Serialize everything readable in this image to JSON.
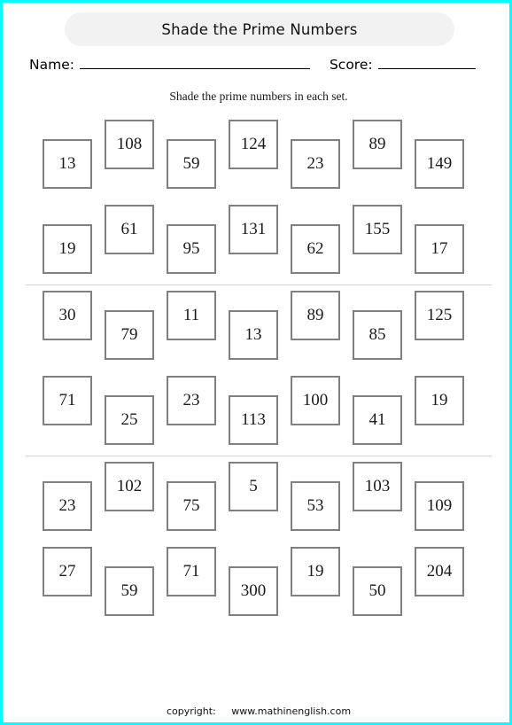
{
  "page": {
    "border_color": "#00ffff",
    "background": "#ffffff"
  },
  "header": {
    "title": "Shade the Prime Numbers",
    "banner_color": "#f2f2f2",
    "name_label": "Name:",
    "score_label": "Score:",
    "name_value": "",
    "score_value": "",
    "instructions": "Shade the prime numbers in each set."
  },
  "box_style": {
    "border_color": "#808080",
    "fill_color": "#ffffff"
  },
  "sets": [
    {
      "index": 1,
      "rows": [
        {
          "start": "down",
          "values": [
            "13",
            "108",
            "59",
            "124",
            "23",
            "89",
            "149"
          ]
        },
        {
          "start": "down",
          "values": [
            "19",
            "61",
            "95",
            "131",
            "62",
            "155",
            "17"
          ]
        }
      ]
    },
    {
      "index": 2,
      "rows": [
        {
          "start": "up",
          "values": [
            "30",
            "79",
            "11",
            "13",
            "89",
            "85",
            "125"
          ]
        },
        {
          "start": "up",
          "values": [
            "71",
            "25",
            "23",
            "113",
            "100",
            "41",
            "19"
          ]
        }
      ]
    },
    {
      "index": 3,
      "rows": [
        {
          "start": "down",
          "values": [
            "23",
            "102",
            "75",
            "5",
            "53",
            "103",
            "109"
          ]
        },
        {
          "start": "up",
          "values": [
            "27",
            "59",
            "71",
            "300",
            "19",
            "50",
            "204"
          ]
        }
      ]
    }
  ],
  "footer": {
    "copyright_label": "copyright:",
    "site": "www.mathinenglish.com"
  }
}
